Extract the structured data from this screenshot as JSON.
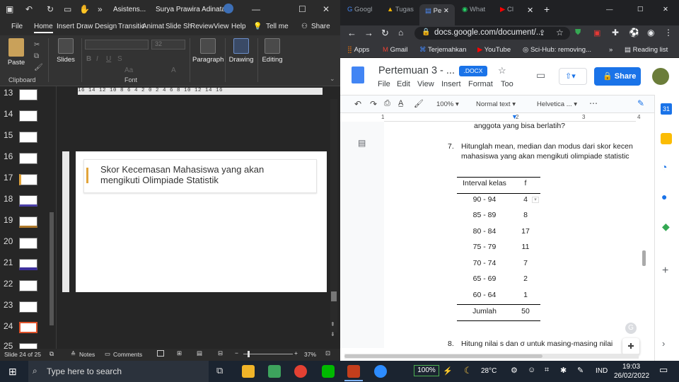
{
  "ppt": {
    "tabs_title": "Asistens...",
    "user_name": "Surya Prawira Adinata",
    "menu": [
      "File",
      "Home",
      "Insert",
      "Draw",
      "Design",
      "Transitic",
      "Animat",
      "Slide Sh",
      "Review",
      "View",
      "Help"
    ],
    "tell_me": "Tell me",
    "share": "Share",
    "ribbon": {
      "paste": "Paste",
      "slides": "Slides",
      "paragraph": "Paragraph",
      "drawing": "Drawing",
      "editing": "Editing",
      "font_size": "32",
      "clipboard_group": "Clipboard",
      "font_group": "Font"
    },
    "thumb_numbers": [
      "13",
      "14",
      "15",
      "16",
      "17",
      "18",
      "19",
      "20",
      "21",
      "22",
      "23",
      "24",
      "25"
    ],
    "ruler_text": "16  14  12  10  8  6  4  2  0  2  4  6  8  10  12  14  16",
    "slide_title_line1": "Skor Kecemasan Mahasiswa yang akan",
    "slide_title_line2": "mengikuti Olimpiade Statistik",
    "status": {
      "slide_info": "Slide 24 of 25",
      "notes": "Notes",
      "comments": "Comments",
      "zoom": "37%"
    }
  },
  "chrome": {
    "tabs": [
      "Googl",
      "Tugas",
      "Pe",
      "What",
      "Cl"
    ],
    "url": "docs.google.com/document/...",
    "bookmarks": [
      "Apps",
      "Gmail",
      "Terjemahkan",
      "YouTube",
      "Sci-Hub: removing...",
      "Reading list"
    ],
    "doc": {
      "title": "Pertemuan 3 - ...",
      "badge": ".DOCX",
      "menu": [
        "File",
        "Edit",
        "View",
        "Insert",
        "Format",
        "Too"
      ],
      "share": "Share",
      "zoom": "100%",
      "style": "Normal text",
      "font": "Helvetica ...",
      "ruler_marks": [
        "1",
        "1",
        "2",
        "3",
        "4"
      ],
      "prev_line": "anggota yang bisa berlatih?",
      "q7_num": "7.",
      "q7_line1": "Hitunglah mean, median dan modus dari skor kecen",
      "q7_line2": "mahasiswa yang akan mengikuti olimpiade statistic",
      "table": {
        "headers": [
          "Interval kelas",
          "f"
        ],
        "rows": [
          {
            "k": "90 - 94",
            "f": "4"
          },
          {
            "k": "85 - 89",
            "f": "8"
          },
          {
            "k": "80 - 84",
            "f": "17"
          },
          {
            "k": "75 - 79",
            "f": "11"
          },
          {
            "k": "70 - 74",
            "f": "7"
          },
          {
            "k": "65 - 69",
            "f": "2"
          },
          {
            "k": "60 - 64",
            "f": "1"
          }
        ],
        "total_label": "Jumlah",
        "total_value": "50"
      },
      "q8_num": "8.",
      "q8_line": "Hitung nilai s dan σ untuk masing-masing nilai"
    }
  },
  "taskbar": {
    "search_placeholder": "Type here to search",
    "battery": "100%",
    "temperature": "28°C",
    "language": "IND",
    "time": "19:03",
    "date": "26/02/2022"
  },
  "colors": {
    "ppt_bg": "#262626",
    "accent_orange": "#e0532b",
    "slide_accent": "#e2a43a",
    "docs_blue": "#1a73e8"
  }
}
